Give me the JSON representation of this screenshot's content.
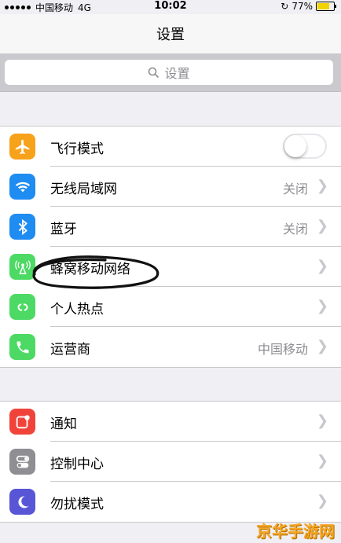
{
  "status_bar": {
    "carrier": "中国移动",
    "network": "4G",
    "time": "10:02",
    "battery": "77%",
    "battery_level": 0.77
  },
  "nav": {
    "title": "设置"
  },
  "search": {
    "placeholder": "设置"
  },
  "group1": [
    {
      "label": "飞行模式",
      "icon": "airplane-icon",
      "color": "#f7a21b",
      "toggle": false
    },
    {
      "label": "无线局域网",
      "icon": "wifi-icon",
      "color": "#1e8cf0",
      "value": "关闭"
    },
    {
      "label": "蓝牙",
      "icon": "bluetooth-icon",
      "color": "#1e8cf0",
      "value": "关闭"
    },
    {
      "label": "蜂窝移动网络",
      "icon": "cellular-icon",
      "color": "#4cd964"
    },
    {
      "label": "个人热点",
      "icon": "hotspot-icon",
      "color": "#4cd964"
    },
    {
      "label": "运营商",
      "icon": "phone-icon",
      "color": "#4cd964",
      "value": "中国移动"
    }
  ],
  "group2": [
    {
      "label": "通知",
      "icon": "notification-icon",
      "color": "#f0443a"
    },
    {
      "label": "控制中心",
      "icon": "control-center-icon",
      "color": "#8e8e93"
    },
    {
      "label": "勿扰模式",
      "icon": "moon-icon",
      "color": "#5856d6"
    }
  ],
  "watermark": "京华手游网"
}
